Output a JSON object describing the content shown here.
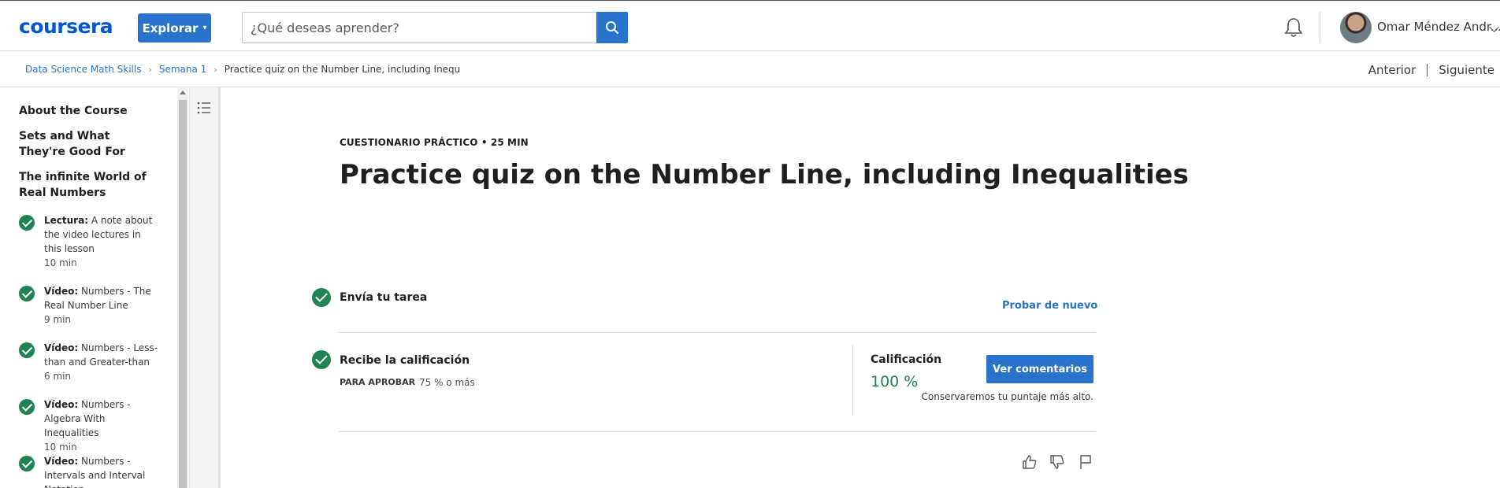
{
  "header": {
    "logo": "coursera",
    "explore_label": "Explorar",
    "search_placeholder": "¿Qué deseas aprender?",
    "user_name": "Omar Méndez Andr..."
  },
  "breadcrumb": {
    "items": [
      "Data Science Math Skills",
      "Semana 1"
    ],
    "current": "Practice quiz on the Number Line, including Inequalities",
    "prev_label": "Anterior",
    "next_label": "Siguiente"
  },
  "sidebar": {
    "headings": [
      "About the Course",
      "Sets and What They're Good For",
      "The infinite World of Real Numbers"
    ],
    "lessons": [
      {
        "type": "Lectura:",
        "title": "A note about the video lectures in this lesson",
        "duration": "10 min"
      },
      {
        "type": "Vídeo:",
        "title": "Numbers - The Real Number Line",
        "duration": "9 min"
      },
      {
        "type": "Vídeo:",
        "title": "Numbers - Less-than and Greater-than",
        "duration": "6 min"
      },
      {
        "type": "Vídeo:",
        "title": "Numbers - Algebra With Inequalities",
        "duration": "10 min"
      },
      {
        "type": "Vídeo:",
        "title": "Numbers - Intervals and Interval Notation",
        "duration": ""
      }
    ]
  },
  "main": {
    "eyebrow": "CUESTIONARIO PRÁCTICO • 25 MIN",
    "title": "Practice quiz on the Number Line, including Inequalities",
    "step1_label": "Envía tu tarea",
    "retry_label": "Probar de nuevo",
    "step2_label": "Recibe la calificación",
    "pass_label": "PARA APROBAR",
    "pass_value": "75 % o más",
    "grade_label": "Calificación",
    "grade_value": "100 %",
    "feedback_label": "Ver comentarios",
    "keep_note": "Conservaremos tu puntaje más alto."
  },
  "colors": {
    "brand": "#0056d2",
    "accent": "#2a73cc",
    "success": "#1f8354"
  },
  "icons": [
    "search-icon",
    "bell-icon",
    "chevron-down-icon",
    "list-icon",
    "check-icon",
    "thumbs-up-icon",
    "thumbs-down-icon",
    "flag-icon"
  ]
}
